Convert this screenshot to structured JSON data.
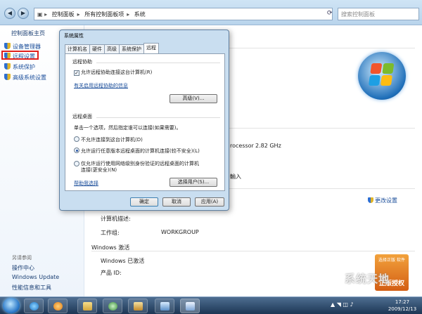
{
  "address_bar": {
    "crumbs": [
      "控制面板",
      "所有控制面板项",
      "系统"
    ],
    "search_placeholder": "搜索控制面板"
  },
  "left_pane": {
    "home": "控制面板主页",
    "items": [
      "设备管理器",
      "远程设置",
      "系统保护",
      "高级系统设置"
    ],
    "see_also": "另请参阅",
    "links": [
      "操作中心",
      "Windows Update",
      "性能信息和工具"
    ]
  },
  "main": {
    "processor_fragment": "rocessor",
    "processor_speed": "2.82 GHz",
    "touch_fragment": "輸入",
    "change_settings": "更改设置",
    "computer_description_label": "计算机描述:",
    "workgroup_label": "工作组:",
    "workgroup_value": "WORKGROUP",
    "activation_heading": "Windows 激活",
    "activated_text": "Windows 已激活",
    "product_id_label": "产品 ID:"
  },
  "genuine_badge": {
    "top": "选择正版 软件",
    "big": "正版授权"
  },
  "dialog": {
    "title": "系统属性",
    "tabs": [
      "计算机名",
      "硬件",
      "高级",
      "系统保护",
      "远程"
    ],
    "active_tab": "远程",
    "remote_assistance": {
      "heading": "远程协助",
      "allow_checkbox": "允许远程协助连接这台计算机(R)",
      "allow_checked": true,
      "link": "有关启用远程协助的信息",
      "advanced_button": "高级(V)..."
    },
    "remote_desktop": {
      "heading": "远程桌面",
      "instruction": "单击一个选项，然后指定谁可以连接(如果需要)。",
      "options": [
        "不允许连接到这台计算机(D)",
        "允许运行任意版本远程桌面的计算机连接(较不安全)(L)",
        "仅允许运行使用网络级别身份验证的远程桌面的计算机连接(更安全)(N)"
      ],
      "selected_index": 1,
      "help_link": "帮助我选择",
      "select_users_button": "选择用户(S)..."
    },
    "buttons": {
      "ok": "确定",
      "cancel": "取消",
      "apply": "应用(A)"
    }
  },
  "taskbar": {
    "time": "17:27",
    "date": "2009/12/13",
    "tray_text": "▲ ◥ ◫ ♪"
  },
  "watermark": "系统天地",
  "colors": {
    "highlight_border": "#e0201c",
    "link": "#1a4d9a",
    "taskbar": "#1d3654"
  }
}
